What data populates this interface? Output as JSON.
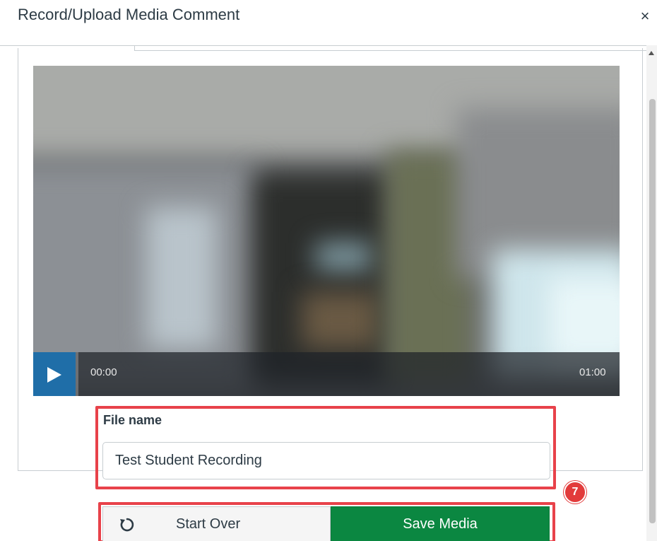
{
  "dialog": {
    "title": "Record/Upload Media Comment",
    "close_glyph": "×"
  },
  "player": {
    "current_time": "00:00",
    "total_time": "01:00",
    "play_icon": "play-icon",
    "accent_color": "#1f6ea8"
  },
  "file": {
    "label": "File name",
    "value": "Test Student Recording"
  },
  "annotation": {
    "step_number": "7",
    "highlight_color": "#e8424a"
  },
  "buttons": {
    "start_over_label": "Start Over",
    "start_over_icon": "refresh-icon",
    "save_label": "Save Media",
    "save_color": "#0b8741"
  }
}
